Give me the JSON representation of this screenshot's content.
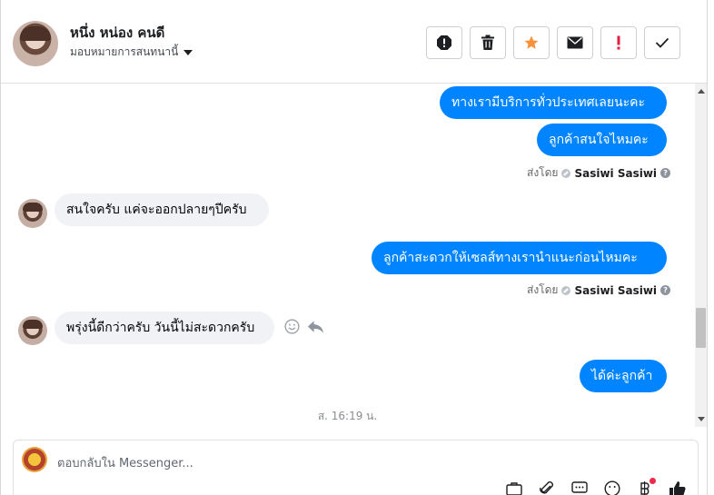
{
  "header": {
    "contact_name": "หนึ่ง หน่อง คนดี",
    "assign_label": "มอบหมายการสนทนานี้",
    "tools": [
      {
        "name": "spam-button",
        "icon": "exclamation-circle-icon"
      },
      {
        "name": "delete-button",
        "icon": "trash-icon"
      },
      {
        "name": "star-button",
        "icon": "star-icon",
        "color": "#f7923b"
      },
      {
        "name": "mark-unread-button",
        "icon": "envelope-icon"
      },
      {
        "name": "follow-up-button",
        "icon": "exclamation-icon",
        "color": "#e41e3f"
      },
      {
        "name": "mark-done-button",
        "icon": "check-icon"
      }
    ]
  },
  "messages": {
    "m1": "ทางเรามีบริการทั่วประเทศเลยนะคะ",
    "m2": "ลูกค้าสนใจไหมคะ",
    "sent_by_label": "ส่งโดย",
    "sent_by_name": "Sasiwi Sasiwi",
    "m3": "สนใจครับ แค่จะออกปลายๆปีครับ",
    "m4": "ลูกค้าสะดวกให้เซลส์ทางเรานำแนะก่อนไหมคะ",
    "m5": "พรุ่งนี้ดีกว่าครับ วันนี้ไม่สะดวกครับ",
    "m6": "ได้ค่ะลูกค้า",
    "timestamp": "ส. 16:19 น."
  },
  "composer": {
    "placeholder": "ตอบกลับใน Messenger..."
  },
  "colors": {
    "outgoing_bubble": "#0084ff",
    "incoming_bubble": "#f0f2f5"
  }
}
